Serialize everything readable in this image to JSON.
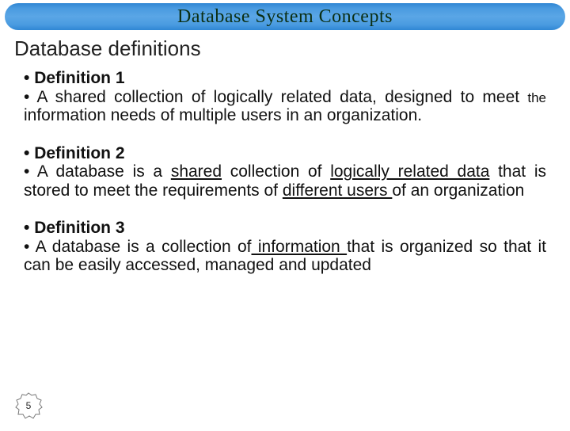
{
  "header": {
    "title": "Database System Concepts"
  },
  "subtitle": "Database definitions",
  "defs": [
    {
      "label": "Definition 1",
      "body_html": "A shared collection of logically related data, designed to meet <span class='sm'>the</span> information needs of multiple users in an organization."
    },
    {
      "label": "Definition 2",
      "body_html": "A database is a <span class='u'>shared</span> collection of <span class='u'>logically related data</span> that is stored to meet the requirements of <span class='u'>different users </span>of an organization"
    },
    {
      "label": "Definition 3",
      "body_html": "A database is a collection of<span class='u'> information </span>that is organized so that it can be easily accessed, managed and updated"
    }
  ],
  "page_number": "5"
}
